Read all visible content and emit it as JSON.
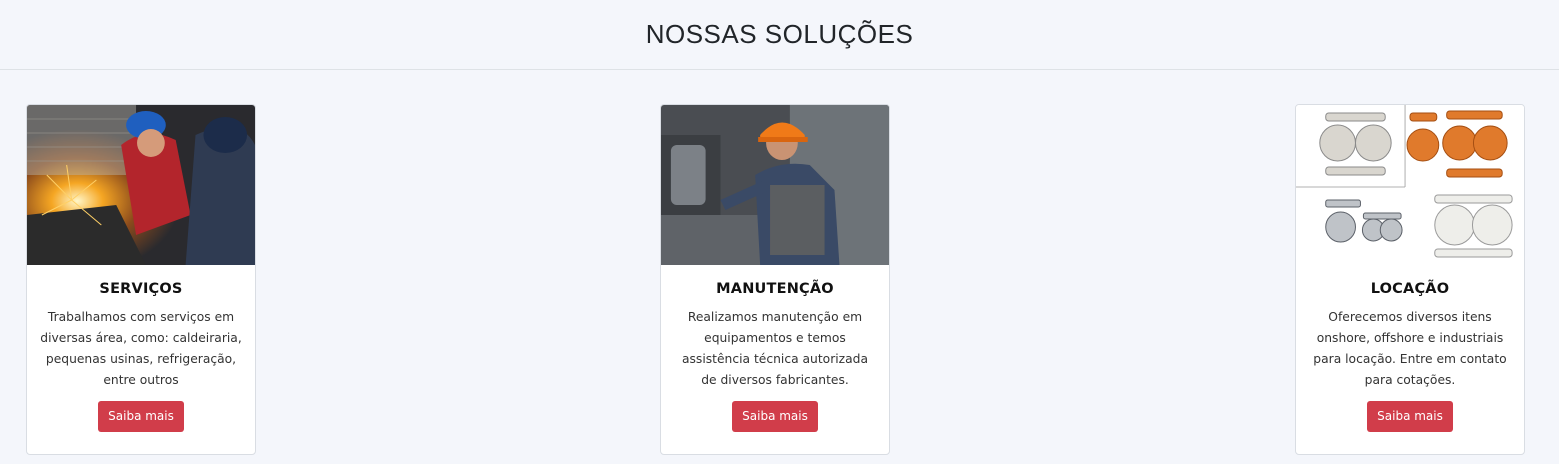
{
  "section": {
    "title": "NOSSAS SOLUÇÕES"
  },
  "cards": [
    {
      "title": "SERVIÇOS",
      "text": "Trabalhamos com serviços em diversas área, como: caldeiraria, pequenas usinas, refrigeração, entre outros",
      "button": "Saiba mais"
    },
    {
      "title": "MANUTENÇÃO",
      "text": "Realizamos manutenção em equipamentos e temos assistência técnica autorizada de diversos fabricantes.",
      "button": "Saiba mais"
    },
    {
      "title": "LOCAÇÃO",
      "text": "Oferecemos diversos itens onshore, offshore e industriais para locação. Entre em contato para cotações.",
      "button": "Saiba mais"
    }
  ],
  "colors": {
    "button": "#d13d4a",
    "background": "#f4f6fb"
  },
  "icons": [
    "welding-photo",
    "technician-photo",
    "pumps-photo"
  ]
}
